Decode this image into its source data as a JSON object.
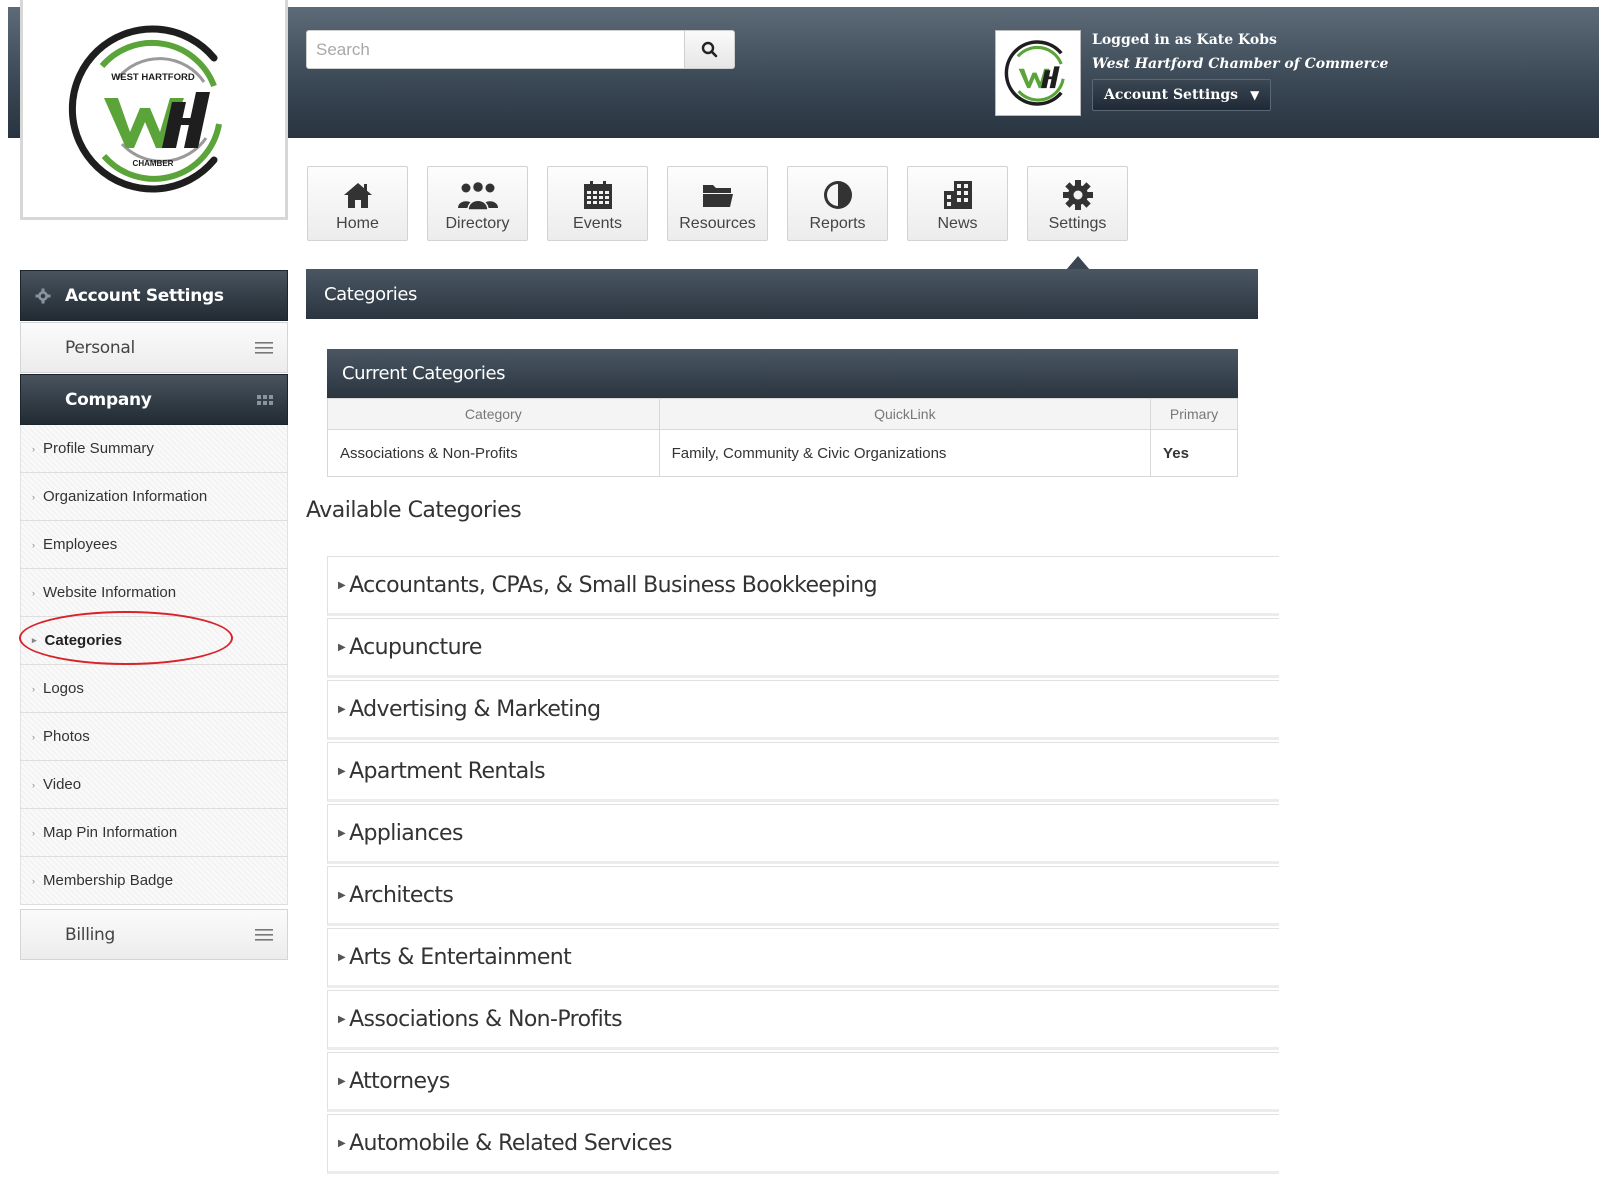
{
  "header": {
    "org_logo": {
      "top_text": "WEST HARTFORD",
      "bottom_text": "CHAMBER",
      "brand_green": "#5aa43a",
      "brand_dark": "#1e1e1e"
    },
    "search": {
      "placeholder": "Search",
      "value": ""
    },
    "user": {
      "login_text": "Logged in as Kate Kobs",
      "org_name": "West Hartford Chamber of Commerce",
      "account_button": "Account Settings",
      "caret": "▼"
    }
  },
  "nav": [
    {
      "label": "Home",
      "icon": "home-icon"
    },
    {
      "label": "Directory",
      "icon": "people-icon"
    },
    {
      "label": "Events",
      "icon": "calendar-icon"
    },
    {
      "label": "Resources",
      "icon": "folder-icon"
    },
    {
      "label": "Reports",
      "icon": "pie-chart-icon"
    },
    {
      "label": "News",
      "icon": "building-icon"
    },
    {
      "label": "Settings",
      "icon": "gear-icon",
      "active": true
    }
  ],
  "sidebar": {
    "title": "Account Settings",
    "groups": [
      {
        "label": "Personal"
      },
      {
        "label": "Company"
      },
      {
        "label": "Billing"
      }
    ],
    "items": [
      {
        "label": "Profile Summary"
      },
      {
        "label": "Organization Information"
      },
      {
        "label": "Employees"
      },
      {
        "label": "Website Information"
      },
      {
        "label": "Categories",
        "active": true
      },
      {
        "label": "Logos"
      },
      {
        "label": "Photos"
      },
      {
        "label": "Video"
      },
      {
        "label": "Map Pin Information"
      },
      {
        "label": "Membership Badge"
      }
    ]
  },
  "main": {
    "title": "Categories",
    "current": {
      "title": "Current Categories",
      "columns": [
        "Category",
        "QuickLink",
        "Primary"
      ],
      "rows": [
        {
          "category": "Associations & Non-Profits",
          "quicklink": "Family, Community & Civic Organizations",
          "primary": "Yes"
        }
      ]
    },
    "available_title": "Available Categories",
    "available": [
      "Accountants, CPAs, & Small Business Bookkeeping",
      "Acupuncture",
      "Advertising & Marketing",
      "Apartment Rentals",
      "Appliances",
      "Architects",
      "Arts & Entertainment",
      "Associations & Non-Profits",
      "Attorneys",
      "Automobile & Related Services"
    ]
  },
  "colors": {
    "header_dark": "#2c3843",
    "highlight_circle": "#d8232a"
  }
}
